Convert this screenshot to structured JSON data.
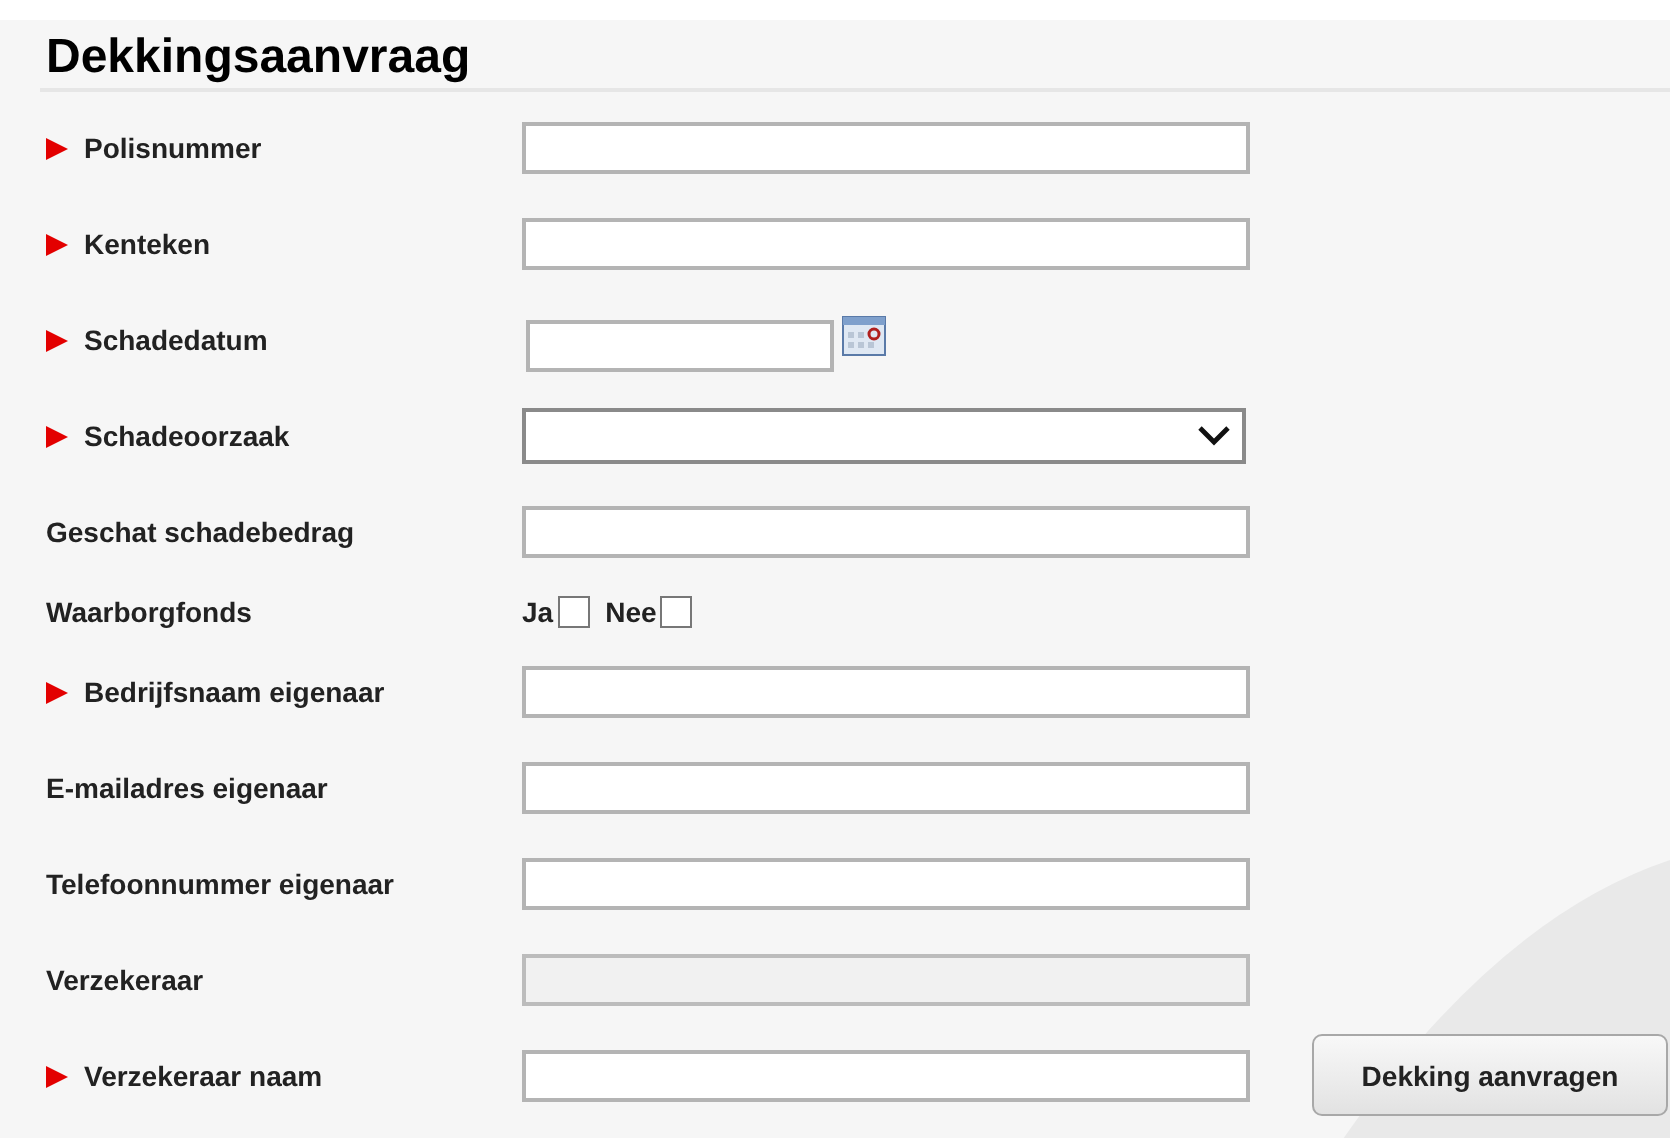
{
  "title": "Dekkingsaanvraag",
  "fields": [
    {
      "kind": "text",
      "label": "Polisnummer",
      "required": true
    },
    {
      "kind": "text",
      "label": "Kenteken",
      "required": true
    },
    {
      "kind": "date",
      "label": "Schadedatum",
      "required": true
    },
    {
      "kind": "select",
      "label": "Schadeoorzaak",
      "required": true
    },
    {
      "kind": "text",
      "label": "Geschat schadebedrag",
      "required": false
    },
    {
      "kind": "checkboxes",
      "label": "Waarborgfonds",
      "required": false,
      "options": [
        {
          "label": "Ja",
          "checked": false
        },
        {
          "label": "Nee",
          "checked": false
        }
      ]
    },
    {
      "kind": "text",
      "label": "Bedrijfsnaam eigenaar",
      "required": true
    },
    {
      "kind": "text",
      "label": "E-mailadres eigenaar",
      "required": false
    },
    {
      "kind": "text",
      "label": "Telefoonnummer eigenaar",
      "required": false
    },
    {
      "kind": "disabled",
      "label": "Verzekeraar",
      "required": false
    },
    {
      "kind": "text",
      "label": "Verzekeraar naam",
      "required": true
    }
  ],
  "submit": "Dekking aanvragen"
}
